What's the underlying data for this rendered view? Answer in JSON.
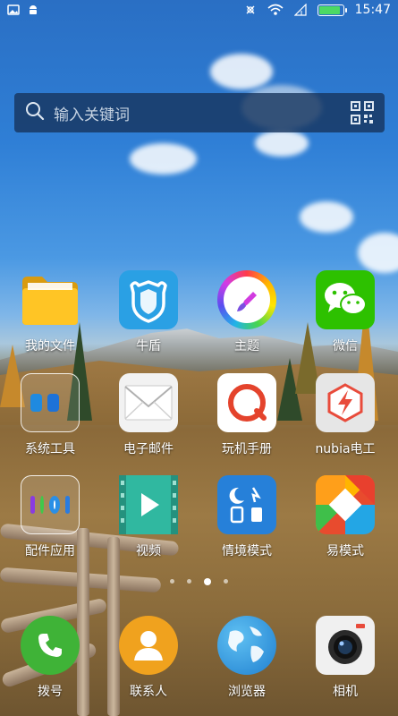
{
  "status_bar": {
    "time": "15:47",
    "left_icons": [
      "gallery-icon",
      "android-icon"
    ],
    "right_icons": [
      "data-sync-icon",
      "wifi-icon",
      "signal-icon",
      "battery-icon"
    ],
    "battery_level": 0.9
  },
  "search": {
    "placeholder": "输入关键词",
    "icon": "search-icon",
    "right_icon": "qr-code-icon"
  },
  "apps_row1": [
    {
      "label": "我的文件",
      "icon": "folder-icon",
      "color": "#f7b81b"
    },
    {
      "label": "牛盾",
      "icon": "shield-icon",
      "color": "#2aa0e4"
    },
    {
      "label": "主题",
      "icon": "theme-brush-icon",
      "color": "#ffffff"
    },
    {
      "label": "微信",
      "icon": "wechat-icon",
      "color": "#2dc100"
    }
  ],
  "apps_row2": [
    {
      "label": "系统工具",
      "icon": "folder-system-tools-icon",
      "color": "#ffffff"
    },
    {
      "label": "电子邮件",
      "icon": "mail-icon",
      "color": "#f2f2f2"
    },
    {
      "label": "玩机手册",
      "icon": "manual-icon",
      "color": "#ffffff"
    },
    {
      "label": "nubia电工",
      "icon": "power-icon",
      "color": "#e6e6e6"
    }
  ],
  "apps_row3": [
    {
      "label": "配件应用",
      "icon": "folder-accessories-icon",
      "color": "#ffffff"
    },
    {
      "label": "视频",
      "icon": "video-icon",
      "color": "#30b8a0"
    },
    {
      "label": "情境模式",
      "icon": "scene-mode-icon",
      "color": "#2680d9"
    },
    {
      "label": "易模式",
      "icon": "easy-mode-icon",
      "color": "#e64a2e"
    }
  ],
  "dock": [
    {
      "label": "拨号",
      "icon": "phone-icon",
      "color": "#3fb337"
    },
    {
      "label": "联系人",
      "icon": "contacts-icon",
      "color": "#f0a21e"
    },
    {
      "label": "浏览器",
      "icon": "browser-globe-icon",
      "color": "#2b8fd6"
    },
    {
      "label": "相机",
      "icon": "camera-icon",
      "color": "#f0f0f0"
    }
  ],
  "page_indicator": {
    "pages": 4,
    "active": 3
  }
}
